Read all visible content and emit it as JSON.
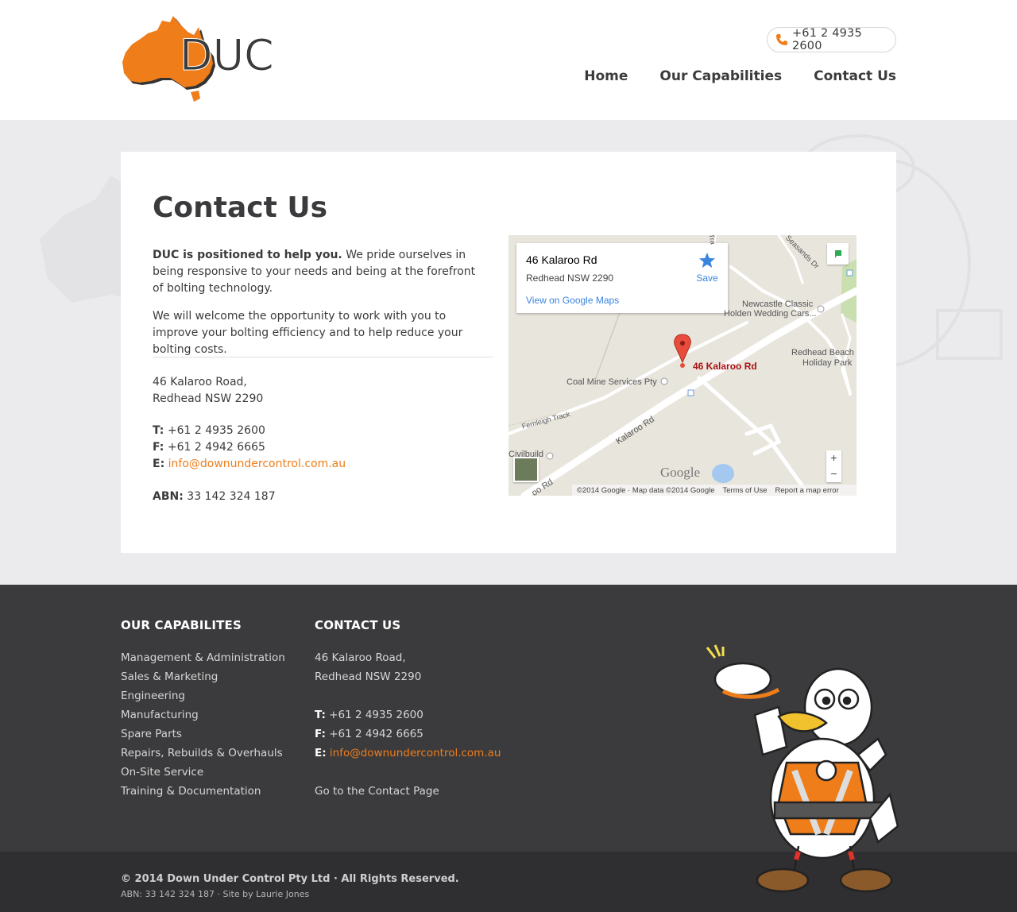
{
  "header": {
    "logo_text": "DUC",
    "phone": "+61 2 4935 2600",
    "nav": [
      {
        "label": "Home"
      },
      {
        "label": "Our Capabilities"
      },
      {
        "label": "Contact Us"
      }
    ]
  },
  "main": {
    "title": "Contact Us",
    "intro_bold": "DUC is positioned to help you.",
    "intro_rest": " We pride ourselves in being responsive to your needs and being at the forefront of bolting technology.",
    "intro_p2": "We will welcome the opportunity to work with you to improve your bolting efficiency and to help reduce your bolting costs.",
    "address_line1": "46 Kalaroo Road,",
    "address_line2": "Redhead NSW 2290",
    "phone_label": "T:",
    "phone": "+61 2 4935 2600",
    "fax_label": "F:",
    "fax": "+61 2 4942 6665",
    "email_label": "E:",
    "email": "info@downundercontrol.com.au",
    "abn_label": "ABN:",
    "abn": "33 142 324 187"
  },
  "map": {
    "info_title": "46 Kalaroo Rd",
    "info_sub": "Redhead NSW 2290",
    "info_link": "View on Google Maps",
    "save_label": "Save",
    "marker_label": "46 Kalaroo Rd",
    "labels": {
      "newcastle": "Newcastle Classic",
      "holden": "Holden Wedding Cars...",
      "redhead_beach": "Redhead Beach",
      "holiday_park": "Holiday Park",
      "coal_mine": "Coal Mine Services Pty",
      "fernleigh": "Fernleigh Track",
      "kalaroo": "Kalaroo Rd",
      "seasands": "Seasands Dr",
      "civilbuild": "Civilbuild",
      "road_bottom": "oo Rd",
      "tra": "Tra"
    },
    "google_word": "Google",
    "footer": {
      "copyright": "©2014 Google · Map data ©2014 Google",
      "terms": "Terms of Use",
      "report": "Report a map error"
    },
    "zoom_in": "+",
    "zoom_out": "−"
  },
  "footer": {
    "cap_heading": "OUR CAPABILITES",
    "capabilities": [
      "Management & Administration",
      "Sales & Marketing",
      "Engineering",
      "Manufacturing",
      "Spare Parts",
      "Repairs, Rebuilds & Overhauls",
      "On-Site Service",
      "Training & Documentation"
    ],
    "contact_heading": "CONTACT US",
    "address_line1": "46 Kalaroo Road,",
    "address_line2": "Redhead NSW 2290",
    "phone_label": "T:",
    "phone": "+61 2 4935 2600",
    "fax_label": "F:",
    "fax": "+61 2 4942 6665",
    "email_label": "E:",
    "email": "info@downundercontrol.com.au",
    "contact_link": "Go to the Contact Page",
    "copyright": "© 2014 Down Under Control Pty Ltd · All Rights Reserved.",
    "abn_credit": "ABN: 33 142 324 187 · Site by Laurie Jones"
  },
  "colors": {
    "accent": "#ef7d1a",
    "dark": "#3b3b3d",
    "footer_bottom": "#2f2f31"
  }
}
